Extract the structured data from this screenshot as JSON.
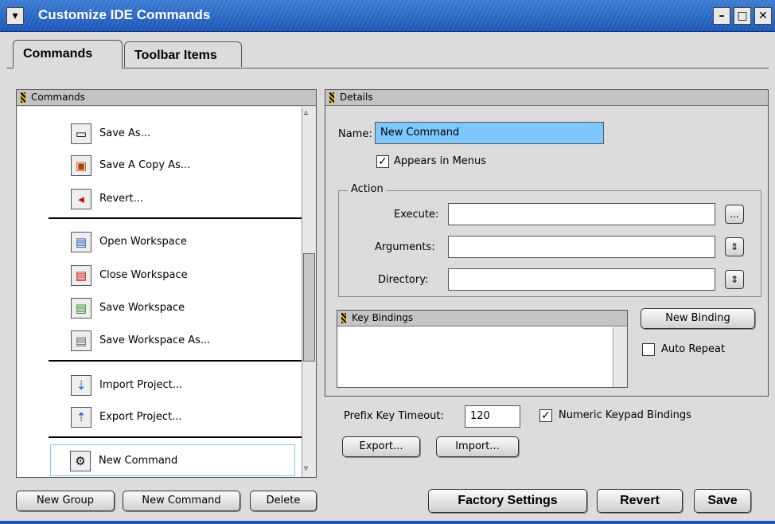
{
  "window": {
    "title": "Customize IDE Commands"
  },
  "tabs": [
    {
      "label": "Commands"
    },
    {
      "label": "Toolbar Items"
    }
  ],
  "commands_panel": {
    "header": "Commands",
    "items": [
      {
        "label": "Save As...",
        "icon": "doc-save-icon"
      },
      {
        "label": "Save A Copy As...",
        "icon": "save-copy-icon"
      },
      {
        "label": "Revert...",
        "icon": "revert-icon"
      },
      {
        "label": "Open Workspace",
        "icon": "open-workspace-icon"
      },
      {
        "label": "Close Workspace",
        "icon": "close-workspace-icon"
      },
      {
        "label": "Save Workspace",
        "icon": "save-workspace-icon"
      },
      {
        "label": "Save Workspace As...",
        "icon": "save-workspace-as-icon"
      },
      {
        "label": "Import Project...",
        "icon": "import-project-icon"
      },
      {
        "label": "Export Project...",
        "icon": "export-project-icon"
      },
      {
        "label": "New Command",
        "icon": "gear-icon"
      }
    ]
  },
  "details": {
    "header": "Details",
    "name_label": "Name:",
    "name_value": "New Command",
    "appears_label": "Appears in Menus",
    "action_label": "Action",
    "execute_label": "Execute:",
    "arguments_label": "Arguments:",
    "directory_label": "Directory:",
    "ellipsis": "...",
    "key_bindings_header": "Key Bindings",
    "new_binding": "New Binding",
    "auto_repeat": "Auto Repeat"
  },
  "prefix": {
    "label": "Prefix Key Timeout:",
    "value": "120",
    "numeric_label": "Numeric Keypad Bindings",
    "export": "Export...",
    "import": "Import..."
  },
  "footer": {
    "new_group": "New Group",
    "new_command": "New Command",
    "delete": "Delete",
    "factory": "Factory Settings",
    "revert": "Revert",
    "save": "Save"
  },
  "colors": {
    "title_bar": "#1a56b8",
    "selection": "#7ec8ff"
  }
}
